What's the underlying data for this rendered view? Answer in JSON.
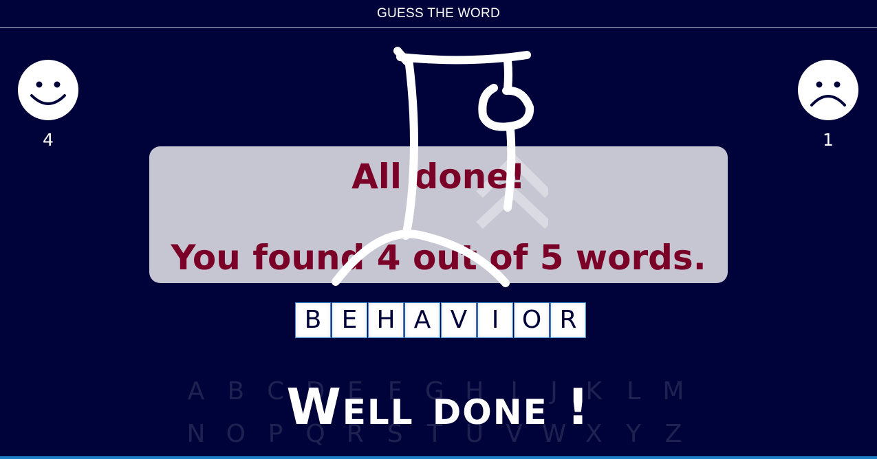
{
  "header": {
    "title": "GUESS THE WORD"
  },
  "scores": {
    "won": {
      "icon": "smiley-face-icon",
      "count": "4"
    },
    "lost": {
      "icon": "sad-face-icon",
      "count": "1"
    }
  },
  "hangman": {
    "icon": "hangman-gallows-icon",
    "stage": "4 of 5 body parts shown"
  },
  "dialog": {
    "title": "All done!",
    "message": "You found 4 out of 5 words."
  },
  "word": {
    "letters": [
      "B",
      "E",
      "H",
      "A",
      "V",
      "I",
      "O",
      "R"
    ]
  },
  "keyboard": {
    "row1": [
      "A",
      "B",
      "C",
      "D",
      "E",
      "F",
      "G",
      "H",
      "I",
      "J",
      "K",
      "L",
      "M"
    ],
    "row2": [
      "N",
      "O",
      "P",
      "Q",
      "R",
      "S",
      "T",
      "U",
      "V",
      "W",
      "X",
      "Y",
      "Z"
    ]
  },
  "banner": {
    "text": "Well done !"
  },
  "colors": {
    "background": "#00033a",
    "dialog_bg": "#c6c6d3",
    "dialog_text": "#7b0028",
    "tile_border": "#3b8fd6"
  }
}
